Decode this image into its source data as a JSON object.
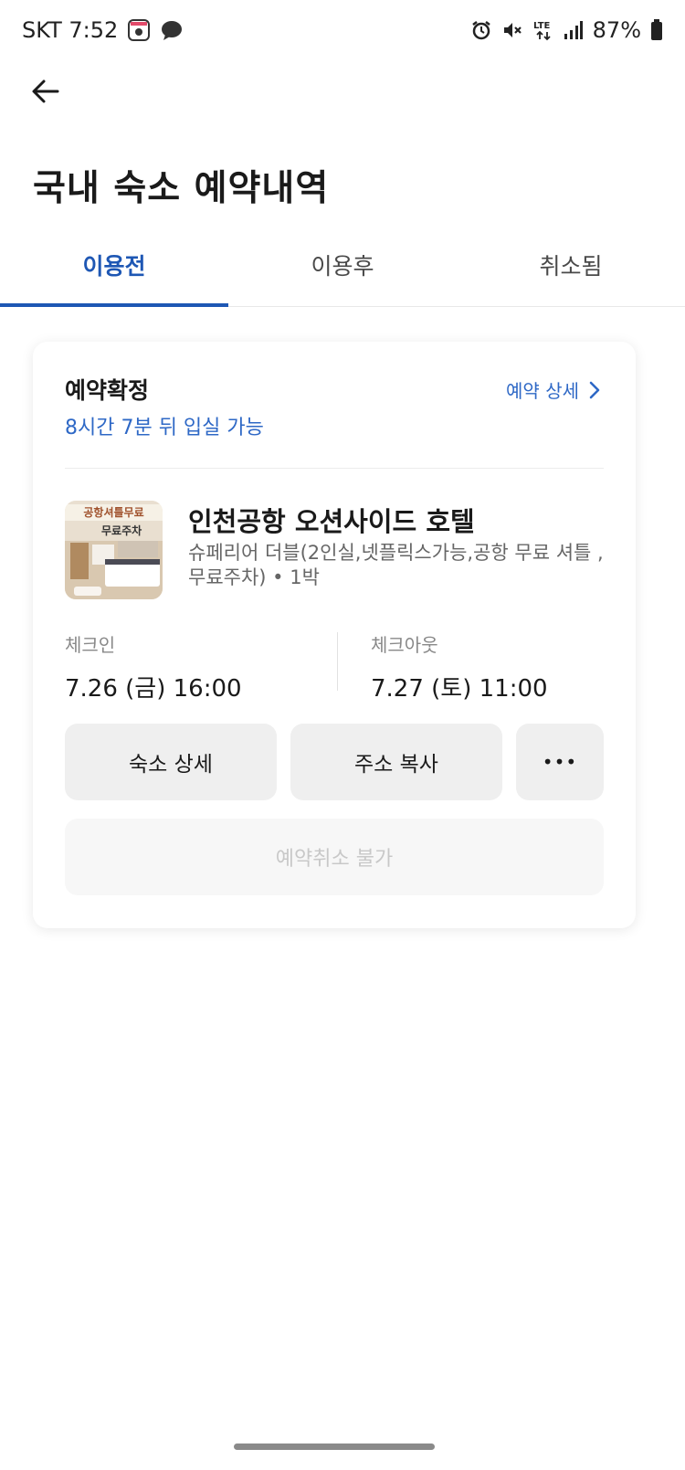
{
  "status_bar": {
    "carrier_time": "SKT 7:52",
    "network": "LTE",
    "battery": "87%",
    "icons": [
      "photo-icon",
      "chat-icon",
      "alarm-icon",
      "mute-icon",
      "lte-icon",
      "signal-icon",
      "battery-icon"
    ]
  },
  "header": {
    "back_icon": "arrow-left-icon",
    "title": "국내 숙소 예약내역"
  },
  "tabs": [
    {
      "label": "이용전",
      "active": true
    },
    {
      "label": "이용후",
      "active": false
    },
    {
      "label": "취소됨",
      "active": false
    }
  ],
  "reservation": {
    "status": "예약확정",
    "status_sub": "8시간 7분 뒤 입실 가능",
    "detail_link": "예약 상세",
    "thumbnail": {
      "banner_1": "공항셔틀무료",
      "banner_2": "무료주차"
    },
    "hotel_name": "인천공항 오션사이드 호텔",
    "room_description": "슈페리어 더블(2인실,넷플릭스가능,공항 무료 셔틀 ,무료주차) • 1박",
    "checkin": {
      "label": "체크인",
      "value": "7.26 (금) 16:00"
    },
    "checkout": {
      "label": "체크아웃",
      "value": "7.27 (토) 11:00"
    },
    "buttons": {
      "hotel_detail": "숙소 상세",
      "copy_address": "주소 복사",
      "more": "•••",
      "cancel": "예약취소 불가"
    }
  },
  "colors": {
    "accent": "#1e57b4",
    "link": "#2e68c6",
    "button_bg": "#efefef"
  }
}
